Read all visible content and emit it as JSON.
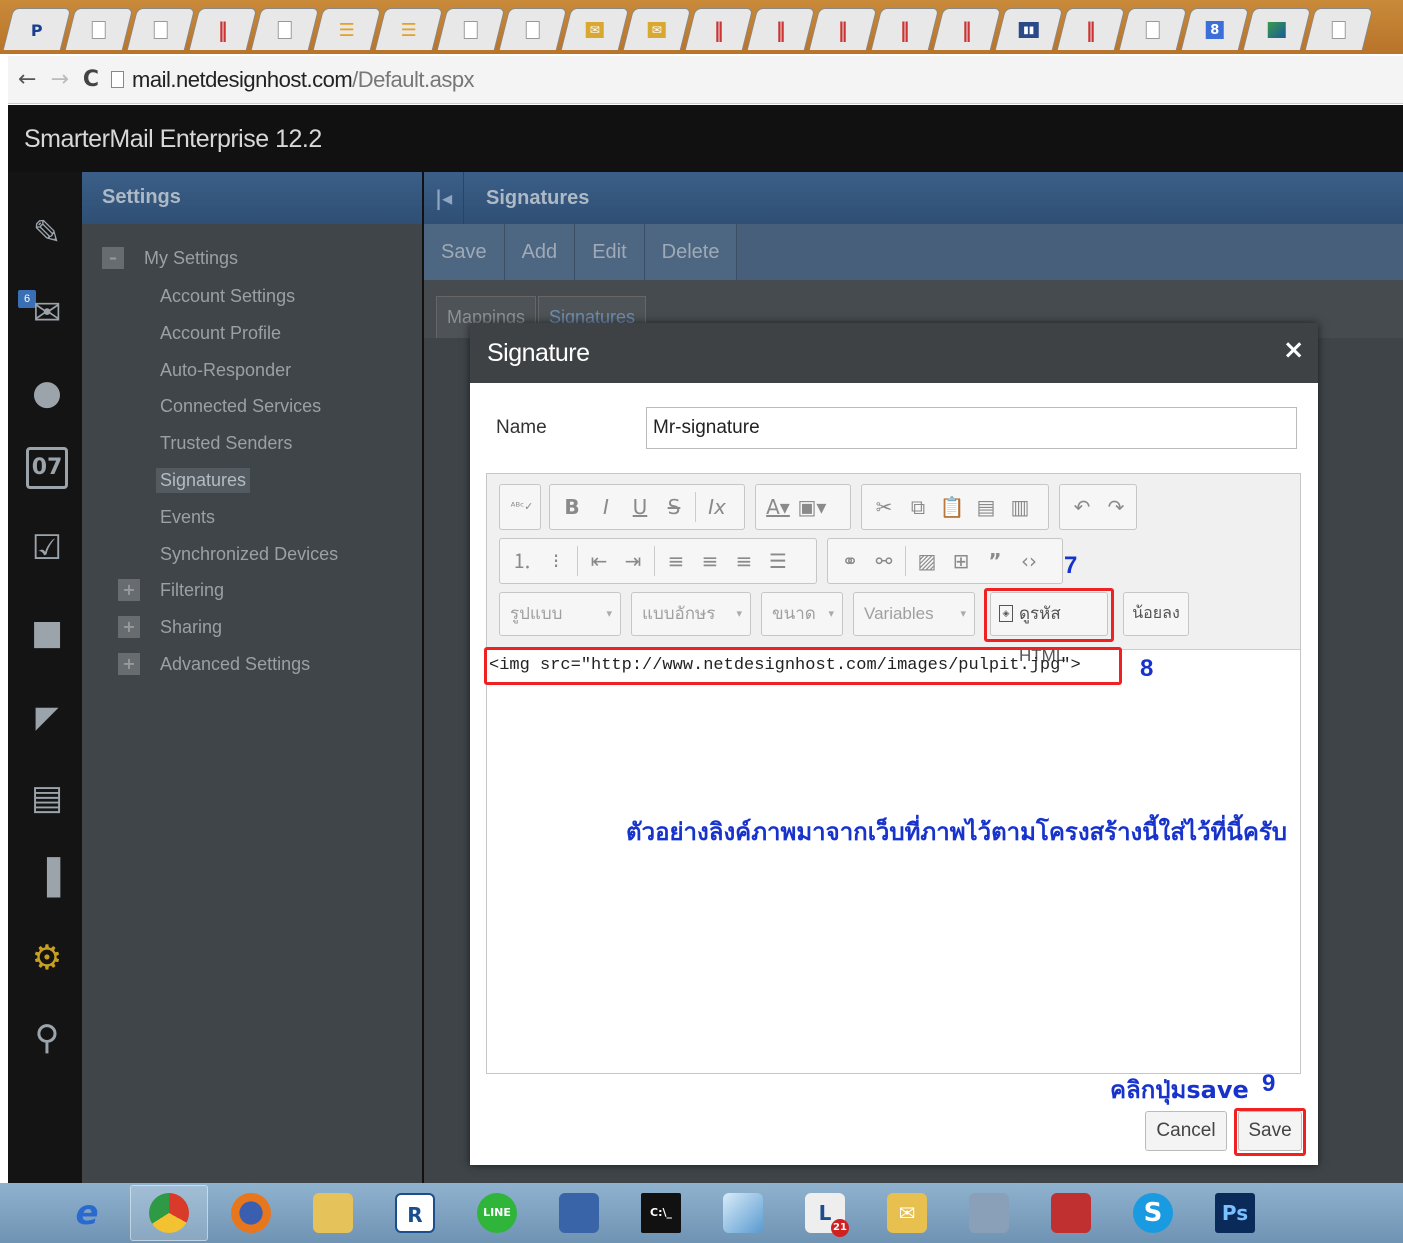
{
  "browser": {
    "tab_icons": [
      "page-favicon",
      "blank-page-icon",
      "blank-page-icon",
      "bars-icon",
      "blank-page-icon",
      "stack-icon",
      "stack-icon",
      "blank-page-icon",
      "blank-page-icon",
      "mail-icon",
      "mail-icon",
      "bars-icon",
      "bars-icon",
      "bars-icon",
      "bars-icon",
      "bars-icon",
      "bars-chart-icon",
      "bars-icon",
      "blank-page-icon",
      "google-icon",
      "map-icon",
      "blank-page-icon"
    ],
    "url_host": "mail.netdesignhost.com",
    "url_path": "/Default.aspx"
  },
  "app": {
    "title": "SmarterMail Enterprise 12.2",
    "inbox_badge": "6",
    "calendar_day": "07"
  },
  "settings": {
    "header": "Settings",
    "group_label": "My Settings",
    "items": [
      "Account Settings",
      "Account Profile",
      "Auto-Responder",
      "Connected Services",
      "Trusted Senders",
      "Signatures",
      "Events",
      "Synchronized Devices"
    ],
    "active_item": "Signatures",
    "expandable": [
      "Filtering",
      "Sharing",
      "Advanced Settings"
    ]
  },
  "main": {
    "title": "Signatures",
    "toolbar": [
      "Save",
      "Add",
      "Edit",
      "Delete"
    ],
    "tabs": [
      "Mappings",
      "Signatures"
    ]
  },
  "modal": {
    "title": "Signature",
    "close": "×",
    "name_label": "Name",
    "name_value": "Mr-signature",
    "editor_toolbar": {
      "style_combo": "รูปแบบ",
      "font_combo": "แบบอักษร",
      "size_combo": "ขนาด",
      "variables_combo": "Variables",
      "source_button": "ดูรหัส HTML",
      "less_button": "น้อยลง"
    },
    "code": "<img src=\"http://www.netdesignhost.com/images/pulpit.jpg\">",
    "cancel_label": "Cancel",
    "save_label": "Save"
  },
  "annotations": {
    "step7": "7",
    "step8": "8",
    "step9": "9",
    "note_center": "ตัวอย่างลิงค์ภาพมาจากเว็บที่ภาพไว้ตามโครงสร้างนี้ใส่ไว้ที่นี้ครับ",
    "note_save": "คลิกปุ่มsave",
    "highlight_color": "#ee2222",
    "text_color": "#1733cc"
  },
  "taskbar": {
    "apps": [
      "ie-icon",
      "chrome-icon",
      "firefox-icon",
      "file-explorer-icon",
      "r-app-icon",
      "line-icon",
      "network-icon",
      "cmd-icon",
      "notes-icon",
      "lc-icon",
      "mail-app-icon",
      "control-panel-icon",
      "archive-icon",
      "skype-icon",
      "photoshop-icon"
    ],
    "lc_badge": "21"
  }
}
